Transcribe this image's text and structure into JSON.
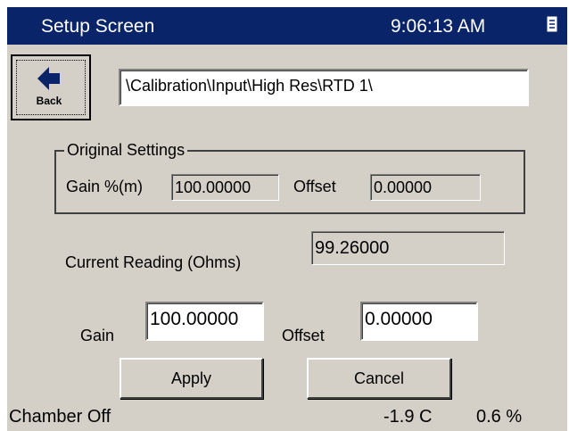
{
  "title_bar": {
    "title": "Setup Screen",
    "clock": "9:06:13 AM",
    "menu_icon": "document-icon",
    "bg_color": "#0a246a"
  },
  "back_button": {
    "label": "Back",
    "icon": "arrow-left-icon",
    "icon_color": "#0a246a"
  },
  "path_field": {
    "value": "\\Calibration\\Input\\High Res\\RTD 1\\"
  },
  "original_settings": {
    "legend": "Original Settings",
    "gain_label": "Gain %(m)",
    "gain_value": "100.00000",
    "offset_label": "Offset",
    "offset_value": "0.00000"
  },
  "current_reading": {
    "label": "Current Reading (Ohms)",
    "value": "99.26000"
  },
  "edit": {
    "gain_label": "Gain",
    "gain_value": "100.00000",
    "offset_label": "Offset",
    "offset_value": "0.00000"
  },
  "buttons": {
    "apply": "Apply",
    "cancel": "Cancel"
  },
  "status_bar": {
    "chamber": "Chamber Off",
    "temperature": "-1.9 C",
    "humidity": "0.6 %"
  }
}
